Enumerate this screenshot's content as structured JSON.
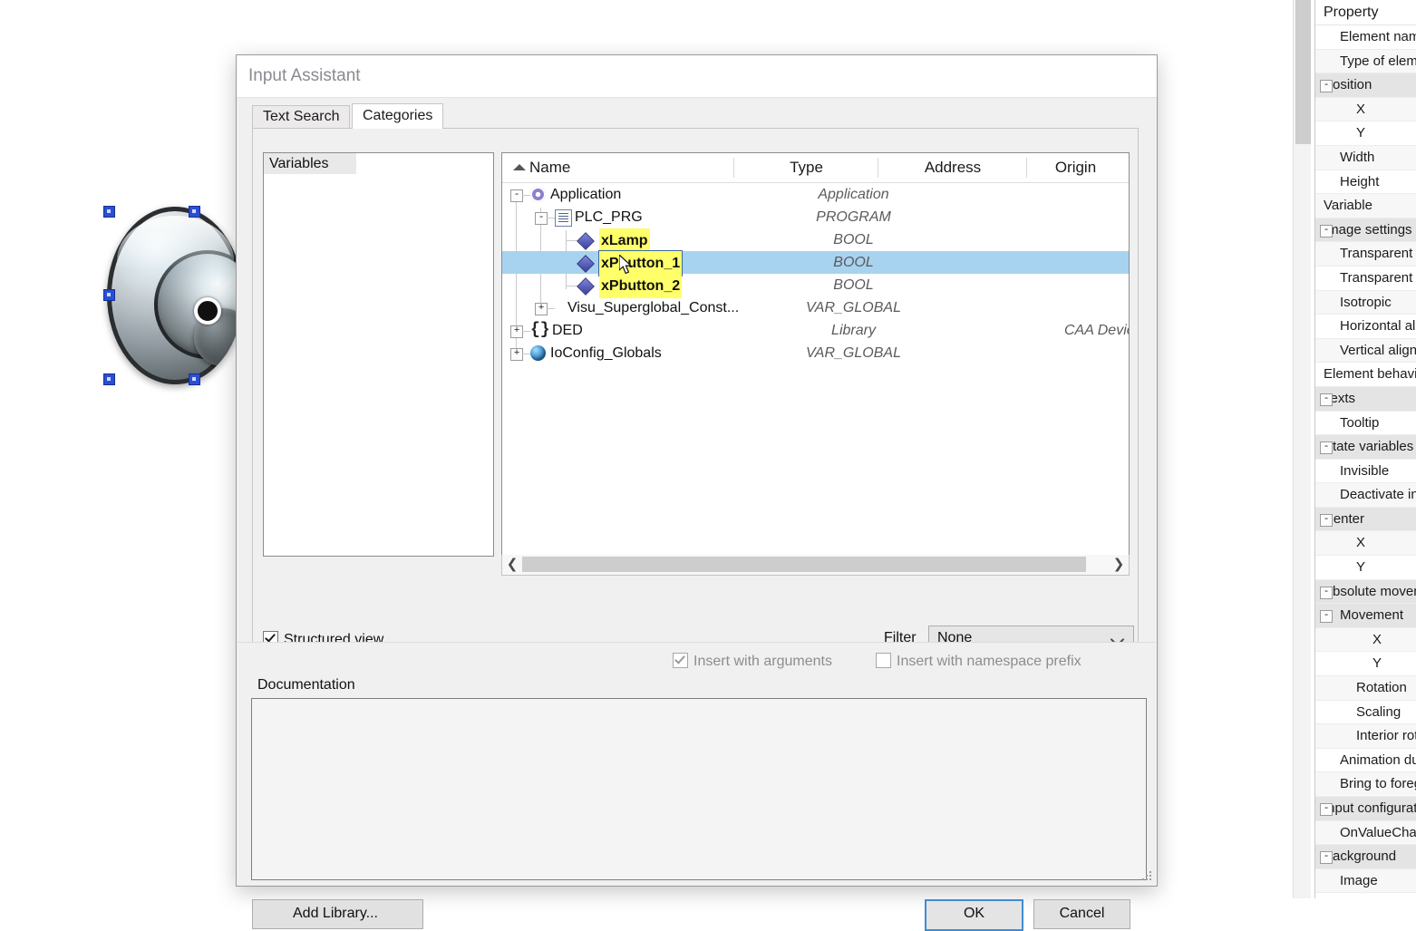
{
  "dialog": {
    "title": "Input Assistant",
    "tabs": [
      {
        "label": "Text Search",
        "active": false
      },
      {
        "label": "Categories",
        "active": true
      }
    ],
    "categories_list": {
      "items": [
        {
          "label": "Variables",
          "selected": true
        }
      ]
    },
    "tree": {
      "columns": [
        "Name",
        "Type",
        "Address",
        "Origin"
      ],
      "sort_indicator": "ascending",
      "rows": [
        {
          "name": "Application",
          "type": "Application",
          "address": "",
          "origin": "",
          "icon": "gear-icon",
          "depth": 0,
          "expander": "-",
          "highlight": false,
          "selected": false
        },
        {
          "name": "PLC_PRG",
          "type": "PROGRAM",
          "address": "",
          "origin": "",
          "icon": "document-icon",
          "depth": 1,
          "expander": "-",
          "highlight": false,
          "selected": false
        },
        {
          "name": "xLamp",
          "type": "BOOL",
          "address": "",
          "origin": "",
          "icon": "variable-diamond-icon",
          "depth": 2,
          "expander": "",
          "highlight": true,
          "selected": false
        },
        {
          "name": "xPbutton_1",
          "type": "BOOL",
          "address": "",
          "origin": "",
          "icon": "variable-diamond-icon",
          "depth": 2,
          "expander": "",
          "highlight": true,
          "selected": true
        },
        {
          "name": "xPbutton_2",
          "type": "BOOL",
          "address": "",
          "origin": "",
          "icon": "variable-diamond-icon",
          "depth": 2,
          "expander": "",
          "highlight": true,
          "selected": false
        },
        {
          "name": "Visu_Superglobal_Const...",
          "type": "VAR_GLOBAL",
          "address": "",
          "origin": "",
          "icon": "none",
          "depth": 1,
          "expander": "+",
          "highlight": false,
          "selected": false
        },
        {
          "name": "DED",
          "type": "Library",
          "address": "",
          "origin": "CAA Device Diagn",
          "icon": "braces-icon",
          "depth": 0,
          "expander": "+",
          "highlight": false,
          "selected": false
        },
        {
          "name": "IoConfig_Globals",
          "type": "VAR_GLOBAL",
          "address": "",
          "origin": "",
          "icon": "globe-icon",
          "depth": 0,
          "expander": "+",
          "highlight": false,
          "selected": false
        }
      ]
    },
    "structured_view": {
      "label": "Structured view",
      "checked": true
    },
    "filter": {
      "label": "Filter",
      "value": "None",
      "options": [
        "None"
      ]
    },
    "insert_with_arguments": {
      "label": "Insert with arguments",
      "checked": true,
      "disabled": true
    },
    "insert_with_namespace_prefix": {
      "label": "Insert with namespace prefix",
      "checked": false,
      "disabled": true
    },
    "documentation": {
      "label": "Documentation",
      "value": ""
    },
    "buttons": {
      "add_library": "Add Library...",
      "ok": "OK",
      "cancel": "Cancel"
    }
  },
  "properties_panel": {
    "header": "Property",
    "rows": [
      {
        "label": "Element name",
        "indent": 2,
        "group": false,
        "expander": ""
      },
      {
        "label": "Type of element",
        "indent": 2,
        "group": false,
        "expander": ""
      },
      {
        "label": "Position",
        "indent": 1,
        "group": true,
        "expander": "-"
      },
      {
        "label": "X",
        "indent": 3,
        "group": false,
        "expander": ""
      },
      {
        "label": "Y",
        "indent": 3,
        "group": false,
        "expander": ""
      },
      {
        "label": "Width",
        "indent": 2,
        "group": false,
        "expander": ""
      },
      {
        "label": "Height",
        "indent": 2,
        "group": false,
        "expander": ""
      },
      {
        "label": "Variable",
        "indent": 1,
        "group": false,
        "expander": ""
      },
      {
        "label": "Image settings",
        "indent": 1,
        "group": true,
        "expander": "-"
      },
      {
        "label": "Transparent",
        "indent": 2,
        "group": false,
        "expander": ""
      },
      {
        "label": "Transparent color",
        "indent": 2,
        "group": false,
        "expander": ""
      },
      {
        "label": "Isotropic",
        "indent": 2,
        "group": false,
        "expander": ""
      },
      {
        "label": "Horizontal alignment",
        "indent": 2,
        "group": false,
        "expander": ""
      },
      {
        "label": "Vertical alignment",
        "indent": 2,
        "group": false,
        "expander": ""
      },
      {
        "label": "Element behaviour",
        "indent": 1,
        "group": false,
        "expander": ""
      },
      {
        "label": "Texts",
        "indent": 1,
        "group": true,
        "expander": "-"
      },
      {
        "label": "Tooltip",
        "indent": 2,
        "group": false,
        "expander": ""
      },
      {
        "label": "State variables",
        "indent": 1,
        "group": true,
        "expander": "-"
      },
      {
        "label": "Invisible",
        "indent": 2,
        "group": false,
        "expander": ""
      },
      {
        "label": "Deactivate inputs",
        "indent": 2,
        "group": false,
        "expander": ""
      },
      {
        "label": "Center",
        "indent": 1,
        "group": true,
        "expander": "-"
      },
      {
        "label": "X",
        "indent": 3,
        "group": false,
        "expander": ""
      },
      {
        "label": "Y",
        "indent": 3,
        "group": false,
        "expander": ""
      },
      {
        "label": "Absolute movement",
        "indent": 1,
        "group": true,
        "expander": "-"
      },
      {
        "label": "Movement",
        "indent": 2,
        "group": true,
        "expander": "-"
      },
      {
        "label": "X",
        "indent": 4,
        "group": false,
        "expander": ""
      },
      {
        "label": "Y",
        "indent": 4,
        "group": false,
        "expander": ""
      },
      {
        "label": "Rotation",
        "indent": 3,
        "group": false,
        "expander": ""
      },
      {
        "label": "Scaling",
        "indent": 3,
        "group": false,
        "expander": ""
      },
      {
        "label": "Interior rotation",
        "indent": 3,
        "group": false,
        "expander": ""
      },
      {
        "label": "Animation duration",
        "indent": 2,
        "group": false,
        "expander": ""
      },
      {
        "label": "Bring to foreground",
        "indent": 2,
        "group": false,
        "expander": ""
      },
      {
        "label": "Input configuration",
        "indent": 1,
        "group": true,
        "expander": "-"
      },
      {
        "label": "OnValueChanged",
        "indent": 2,
        "group": false,
        "expander": ""
      },
      {
        "label": "Background",
        "indent": 1,
        "group": true,
        "expander": "-"
      },
      {
        "label": "Image",
        "indent": 2,
        "group": false,
        "expander": ""
      }
    ]
  },
  "canvas": {
    "element": {
      "name": "rotary-knob-image",
      "selected": true,
      "handles": 6
    }
  },
  "colors": {
    "selection_row": "#a8d3f0",
    "search_highlight": "#ffff6a",
    "selection_handle": "#2a4fd6",
    "default_button_border": "#3f8cd4"
  }
}
